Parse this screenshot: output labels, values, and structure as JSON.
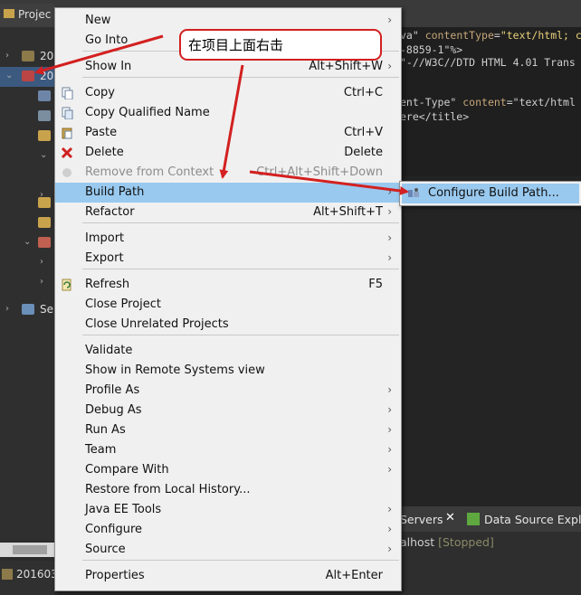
{
  "project_explorer": {
    "title": "Projec",
    "rows": [
      {
        "label": "20"
      },
      {
        "label": "20"
      },
      {
        "label": ""
      },
      {
        "label": ""
      },
      {
        "label": ""
      },
      {
        "label": "Se"
      }
    ],
    "bottom_item": "201603"
  },
  "editor": {
    "lines": [
      {
        "parts": [
          {
            "c": "kw",
            "t": "va\" "
          },
          {
            "c": "attr",
            "t": "contentType"
          },
          {
            "c": "kw",
            "t": "="
          },
          {
            "c": "str",
            "t": "\"text/html; c"
          }
        ]
      },
      {
        "parts": [
          {
            "c": "kw",
            "t": "-8859-1\"%>"
          }
        ]
      },
      {
        "parts": [
          {
            "c": "kw",
            "t": "\"-//W3C//DTD HTML 4.01 Trans"
          }
        ]
      },
      {
        "parts": [
          {
            "c": "kw",
            "t": ""
          }
        ]
      },
      {
        "parts": [
          {
            "c": "kw",
            "t": "ent-Type\" "
          },
          {
            "c": "attr",
            "t": "content"
          },
          {
            "c": "kw",
            "t": "=\"text/html"
          }
        ]
      },
      {
        "parts": [
          {
            "c": "kw",
            "t": "ere</title>"
          }
        ]
      }
    ]
  },
  "servers": {
    "tab_label": "Servers",
    "close_glyph": "✕",
    "tab2_label": "Data Source Explo",
    "host_prefix": "alhost",
    "status": "[Stopped]"
  },
  "context_menu": {
    "items": [
      {
        "id": "new",
        "label": "New",
        "shortcut": "",
        "submenu": true,
        "icon": ""
      },
      {
        "id": "go-into",
        "label": "Go Into",
        "shortcut": "",
        "submenu": false,
        "icon": ""
      },
      {
        "id": "show-in",
        "label": "Show In",
        "shortcut": "Alt+Shift+W",
        "submenu": true,
        "icon": ""
      },
      {
        "id": "copy",
        "label": "Copy",
        "shortcut": "Ctrl+C",
        "submenu": false,
        "icon": "copy-icon"
      },
      {
        "id": "copy-qualified-name",
        "label": "Copy Qualified Name",
        "shortcut": "",
        "submenu": false,
        "icon": "copy-qualified-icon"
      },
      {
        "id": "paste",
        "label": "Paste",
        "shortcut": "Ctrl+V",
        "submenu": false,
        "icon": "paste-icon"
      },
      {
        "id": "delete",
        "label": "Delete",
        "shortcut": "Delete",
        "submenu": false,
        "icon": "delete-icon"
      },
      {
        "id": "remove-from-context",
        "label": "Remove from Context",
        "shortcut": "Ctrl+Alt+Shift+Down",
        "submenu": false,
        "icon": "remove-context-icon",
        "disabled": true
      },
      {
        "id": "build-path",
        "label": "Build Path",
        "shortcut": "",
        "submenu": true,
        "icon": "",
        "highlighted": true
      },
      {
        "id": "refactor",
        "label": "Refactor",
        "shortcut": "Alt+Shift+T",
        "submenu": true,
        "icon": ""
      },
      {
        "id": "import",
        "label": "Import",
        "shortcut": "",
        "submenu": true,
        "icon": ""
      },
      {
        "id": "export",
        "label": "Export",
        "shortcut": "",
        "submenu": true,
        "icon": ""
      },
      {
        "id": "refresh",
        "label": "Refresh",
        "shortcut": "F5",
        "submenu": false,
        "icon": "refresh-icon"
      },
      {
        "id": "close-project",
        "label": "Close Project",
        "shortcut": "",
        "submenu": false,
        "icon": ""
      },
      {
        "id": "close-unrelated-projects",
        "label": "Close Unrelated Projects",
        "shortcut": "",
        "submenu": false,
        "icon": ""
      },
      {
        "id": "validate",
        "label": "Validate",
        "shortcut": "",
        "submenu": false,
        "icon": ""
      },
      {
        "id": "show-in-remote-systems-view",
        "label": "Show in Remote Systems view",
        "shortcut": "",
        "submenu": false,
        "icon": ""
      },
      {
        "id": "profile-as",
        "label": "Profile As",
        "shortcut": "",
        "submenu": true,
        "icon": ""
      },
      {
        "id": "debug-as",
        "label": "Debug As",
        "shortcut": "",
        "submenu": true,
        "icon": ""
      },
      {
        "id": "run-as",
        "label": "Run As",
        "shortcut": "",
        "submenu": true,
        "icon": ""
      },
      {
        "id": "team",
        "label": "Team",
        "shortcut": "",
        "submenu": true,
        "icon": ""
      },
      {
        "id": "compare-with",
        "label": "Compare With",
        "shortcut": "",
        "submenu": true,
        "icon": ""
      },
      {
        "id": "restore-from-local-history",
        "label": "Restore from Local History...",
        "shortcut": "",
        "submenu": false,
        "icon": ""
      },
      {
        "id": "java-ee-tools",
        "label": "Java EE Tools",
        "shortcut": "",
        "submenu": true,
        "icon": ""
      },
      {
        "id": "configure",
        "label": "Configure",
        "shortcut": "",
        "submenu": true,
        "icon": ""
      },
      {
        "id": "source",
        "label": "Source",
        "shortcut": "",
        "submenu": true,
        "icon": ""
      },
      {
        "id": "properties",
        "label": "Properties",
        "shortcut": "Alt+Enter",
        "submenu": false,
        "icon": ""
      }
    ],
    "submenu_arrow": "›"
  },
  "build_path_submenu": {
    "item_label": "Configure Build Path...",
    "icon": "configure-build-path-icon"
  },
  "annotation": {
    "callout_text": "在项目上面右击",
    "color": "#d32020"
  },
  "colors": {
    "menu_bg": "#f0f0f0",
    "highlight": "#99c9ef",
    "annotation_red": "#d32020"
  }
}
